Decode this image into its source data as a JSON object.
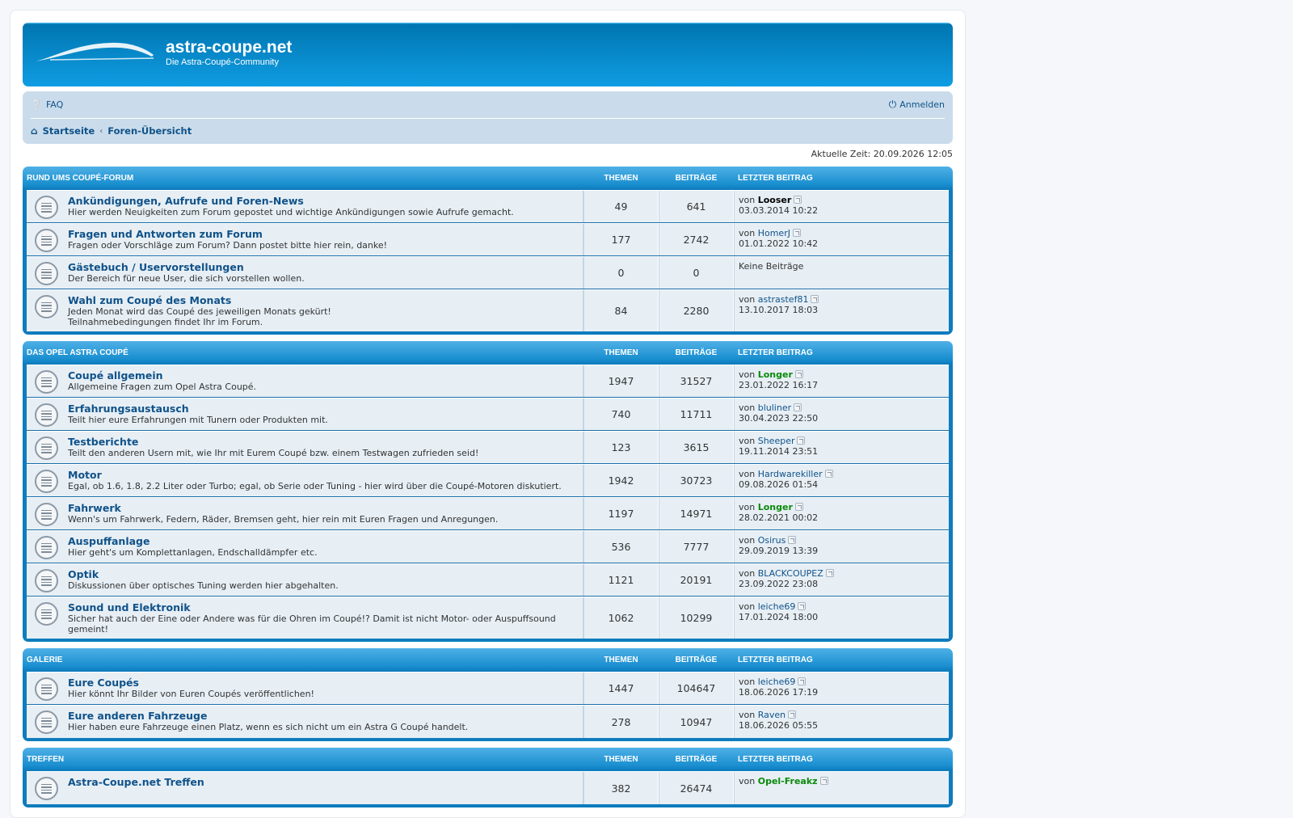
{
  "header": {
    "site_title": "astra-coupe.net",
    "site_desc": "Die Astra-Coupé-Community"
  },
  "nav": {
    "faq": "FAQ",
    "login": "Anmelden",
    "breadcrumb": [
      "Startseite",
      "Foren-Übersicht"
    ]
  },
  "current_time": "Aktuelle Zeit: 20.09.2026 12:05",
  "column_labels": {
    "topics": "THEMEN",
    "posts": "BEITRÄGE",
    "last": "LETZTER BEITRAG"
  },
  "by_label": "von",
  "categories": [
    {
      "name": "RUND UMS COUPÉ-FORUM",
      "forums": [
        {
          "title": "Ankündigungen, Aufrufe und Foren-News",
          "desc": [
            "Hier werden Neuigkeiten zum Forum gepostet und wichtige Ankündigungen sowie Aufrufe gemacht."
          ],
          "topics": "49",
          "posts": "641",
          "user": "Looser",
          "role": "admin",
          "date": "03.03.2014 10:22"
        },
        {
          "title": "Fragen und Antworten zum Forum",
          "desc": [
            "Fragen oder Vorschläge zum Forum? Dann postet bitte hier rein, danke!"
          ],
          "topics": "177",
          "posts": "2742",
          "user": "HomerJ",
          "role": "user",
          "date": "01.01.2022 10:42"
        },
        {
          "title": "Gästebuch / Uservorstellungen",
          "desc": [
            "Der Bereich für neue User, die sich vorstellen wollen."
          ],
          "topics": "0",
          "posts": "0",
          "none": "Keine Beiträge"
        },
        {
          "title": "Wahl zum Coupé des Monats",
          "desc": [
            "Jeden Monat wird das Coupé des jeweiligen Monats gekürt!",
            "Teilnahmebedingungen findet Ihr im Forum."
          ],
          "topics": "84",
          "posts": "2280",
          "user": "astrastef81",
          "role": "user",
          "date": "13.10.2017 18:03"
        }
      ]
    },
    {
      "name": "DAS OPEL ASTRA COUPÉ",
      "forums": [
        {
          "title": "Coupé allgemein",
          "desc": [
            "Allgemeine Fragen zum Opel Astra Coupé."
          ],
          "topics": "1947",
          "posts": "31527",
          "user": "Longer",
          "role": "mod",
          "date": "23.01.2022 16:17"
        },
        {
          "title": "Erfahrungsaustausch",
          "desc": [
            "Teilt hier eure Erfahrungen mit Tunern oder Produkten mit."
          ],
          "topics": "740",
          "posts": "11711",
          "user": "bluliner",
          "role": "user",
          "date": "30.04.2023 22:50"
        },
        {
          "title": "Testberichte",
          "desc": [
            "Teilt den anderen Usern mit, wie Ihr mit Eurem Coupé bzw. einem Testwagen zufrieden seid!"
          ],
          "topics": "123",
          "posts": "3615",
          "user": "Sheeper",
          "role": "user",
          "date": "19.11.2014 23:51"
        },
        {
          "title": "Motor",
          "desc": [
            "Egal, ob 1.6, 1.8, 2.2 Liter oder Turbo; egal, ob Serie oder Tuning - hier wird über die Coupé-Motoren diskutiert."
          ],
          "topics": "1942",
          "posts": "30723",
          "user": "Hardwarekiller",
          "role": "user",
          "date": "09.08.2026 01:54"
        },
        {
          "title": "Fahrwerk",
          "desc": [
            "Wenn's um Fahrwerk, Federn, Räder, Bremsen geht, hier rein mit Euren Fragen und Anregungen."
          ],
          "topics": "1197",
          "posts": "14971",
          "user": "Longer",
          "role": "mod",
          "date": "28.02.2021 00:02"
        },
        {
          "title": "Auspuffanlage",
          "desc": [
            "Hier geht's um Komplettanlagen, Endschalldämpfer etc."
          ],
          "topics": "536",
          "posts": "7777",
          "user": "Osirus",
          "role": "user",
          "date": "29.09.2019 13:39"
        },
        {
          "title": "Optik",
          "desc": [
            "Diskussionen über optisches Tuning werden hier abgehalten."
          ],
          "topics": "1121",
          "posts": "20191",
          "user": "BLACKCOUPEZ",
          "role": "user",
          "date": "23.09.2022 23:08"
        },
        {
          "title": "Sound und Elektronik",
          "desc": [
            "Sicher hat auch der Eine oder Andere was für die Ohren im Coupé!? Damit ist nicht Motor- oder Auspuffsound",
            "gemeint!"
          ],
          "topics": "1062",
          "posts": "10299",
          "user": "leiche69",
          "role": "user",
          "date": "17.01.2024 18:00"
        }
      ]
    },
    {
      "name": "GALERIE",
      "forums": [
        {
          "title": "Eure Coupés",
          "desc": [
            "Hier könnt Ihr Bilder von Euren Coupés veröffentlichen!"
          ],
          "topics": "1447",
          "posts": "104647",
          "user": "leiche69",
          "role": "user",
          "date": "18.06.2026 17:19"
        },
        {
          "title": "Eure anderen Fahrzeuge",
          "desc": [
            "Hier haben eure Fahrzeuge einen Platz, wenn es sich nicht um ein Astra G Coupé handelt."
          ],
          "topics": "278",
          "posts": "10947",
          "user": "Raven",
          "role": "user",
          "date": "18.06.2026 05:55"
        }
      ]
    },
    {
      "name": "TREFFEN",
      "forums": [
        {
          "title": "Astra-Coupe.net Treffen",
          "desc": [],
          "topics": "382",
          "posts": "26474",
          "user": "Opel-Freakz",
          "role": "mod",
          "date": ""
        }
      ]
    }
  ]
}
